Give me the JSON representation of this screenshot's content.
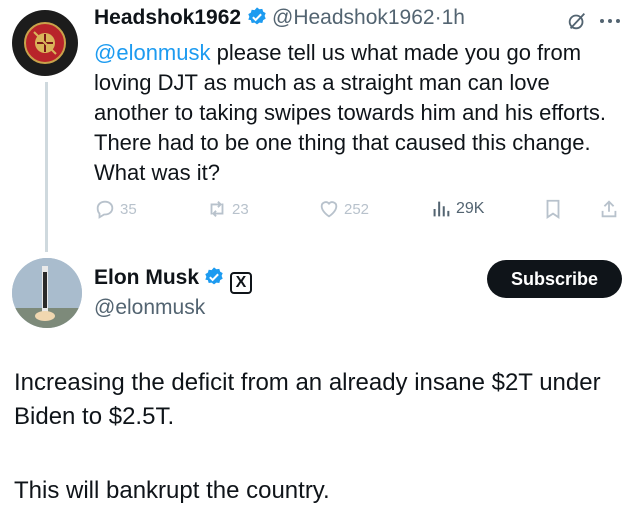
{
  "reply": {
    "author_name": "Headshok1962",
    "author_handle": "@Headshok1962",
    "separator": "·",
    "time": "1h",
    "mention": "@elonmusk",
    "text": "please tell us what made you go from loving DJT as much as a straight man can love another to taking swipes towards him and his efforts.  There had to be one thing that caused this change.  What was it?",
    "replies_count": "35",
    "reposts_count": "23",
    "likes_count": "252",
    "views_count": "29K",
    "avatar_text_top": "UNITED STATES",
    "avatar_text_bottom": "MARINE CORPS"
  },
  "post": {
    "author_name": "Elon Musk",
    "author_handle": "@elonmusk",
    "subscribe_label": "Subscribe",
    "x_badge": "X",
    "paragraph1": "Increasing the deficit from an already insane $2T under Biden to $2.5T.",
    "paragraph2": "This will bankrupt the country."
  },
  "colors": {
    "verified": "#1d9bf0",
    "mention": "#1d9bf0",
    "text": "#0f1419",
    "muted": "#536471"
  },
  "icons": [
    "grok-icon",
    "more-icon",
    "reply-icon",
    "repost-icon",
    "like-icon",
    "views-icon",
    "bookmark-icon",
    "share-icon",
    "verified-icon"
  ]
}
